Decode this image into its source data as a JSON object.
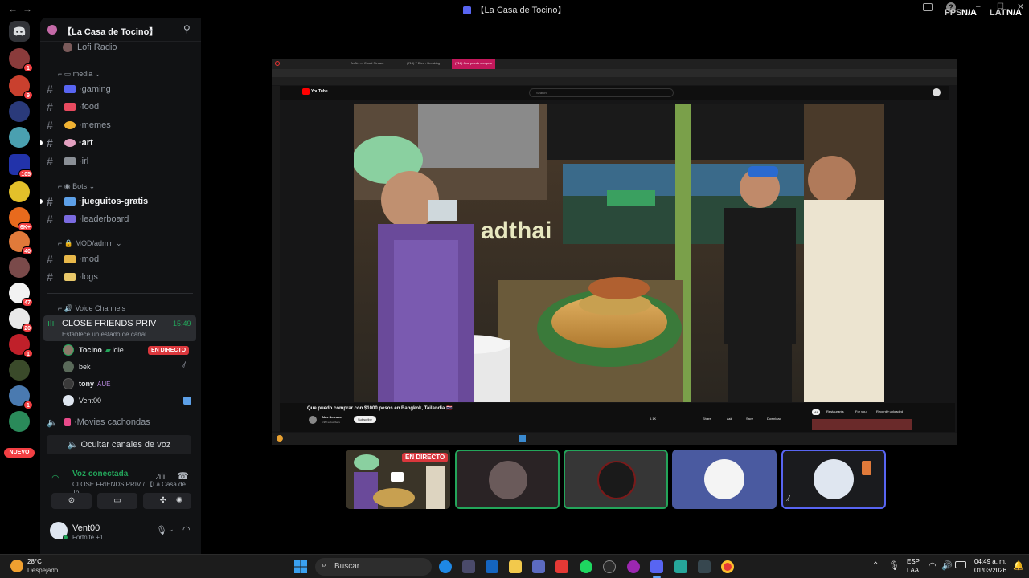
{
  "window": {
    "title": "【La Casa de Tocino】",
    "fps_label": "FPS",
    "fps_value": "N/A",
    "lat_label": "LAT",
    "lat_value": "N/A"
  },
  "rail": {
    "badges": [
      "1",
      "9",
      "",
      "",
      "105",
      "",
      "6K+",
      "40",
      "",
      "47",
      "20",
      "1",
      "",
      "1",
      ""
    ],
    "new_label": "NUEVO"
  },
  "server": {
    "name": "【La Casa de Tocino】",
    "top_partial": "Lofi Radio",
    "categories": {
      "media": "media",
      "bots": "Bots",
      "mod": "MOD/admin",
      "voice": "Voice Channels"
    },
    "channels": {
      "gaming": "gaming",
      "food": "food",
      "memes": "memes",
      "art": "art",
      "irl": "irl",
      "jueguitos": "jueguitos-gratis",
      "leaderboard": "leaderboard",
      "mod": "mod",
      "logs": "logs"
    },
    "voice_channel": {
      "name": "CLOSE FRIENDS PRIV",
      "time": "15:49",
      "status": "Establece un estado de canal"
    },
    "voice_users": [
      {
        "name": "Tocino",
        "tag": "idle",
        "live": "EN DIRECTO"
      },
      {
        "name": "bek"
      },
      {
        "name": "tony",
        "tag": "AUE"
      },
      {
        "name": "Vent00"
      }
    ],
    "other_voice": "Movies cachondas",
    "hide_button": "Ocultar canales de voz"
  },
  "voice_status": {
    "title": "Voz conectada",
    "subtitle": "CLOSE FRIENDS PRIV / 【La Casa de To..."
  },
  "user": {
    "name": "Vent00",
    "activity": "Fortnite +1"
  },
  "stream": {
    "tab_labels": [
      "AnBin — Cloud Stream",
      "(718) 7 Dies - Breaking",
      "(718) Que puedo comprar"
    ],
    "yt_logo": "YouTube",
    "yt_search": "Search",
    "video_title": "Que puedo comprar con $1000 pesos en Bangkok, Tailandia 🇹🇭",
    "channel": "Alex Serrano",
    "subscribers": "5.9M subscribers",
    "subscribe": "Subscribe",
    "likes": "6.1K",
    "actions": [
      "Share",
      "Ask",
      "Save",
      "Download"
    ],
    "chips": [
      "All",
      "Restaurants",
      "For you",
      "Recently uploaded"
    ],
    "sign_text": "adthai"
  },
  "tiles": {
    "live_badge": "EN DIRECTO"
  },
  "taskbar": {
    "weather_temp": "28°C",
    "weather_desc": "Despejado",
    "search": "Buscar",
    "lang1": "ESP",
    "lang2": "LAA",
    "time": "04:49 a. m.",
    "date": "01/03/2026"
  }
}
